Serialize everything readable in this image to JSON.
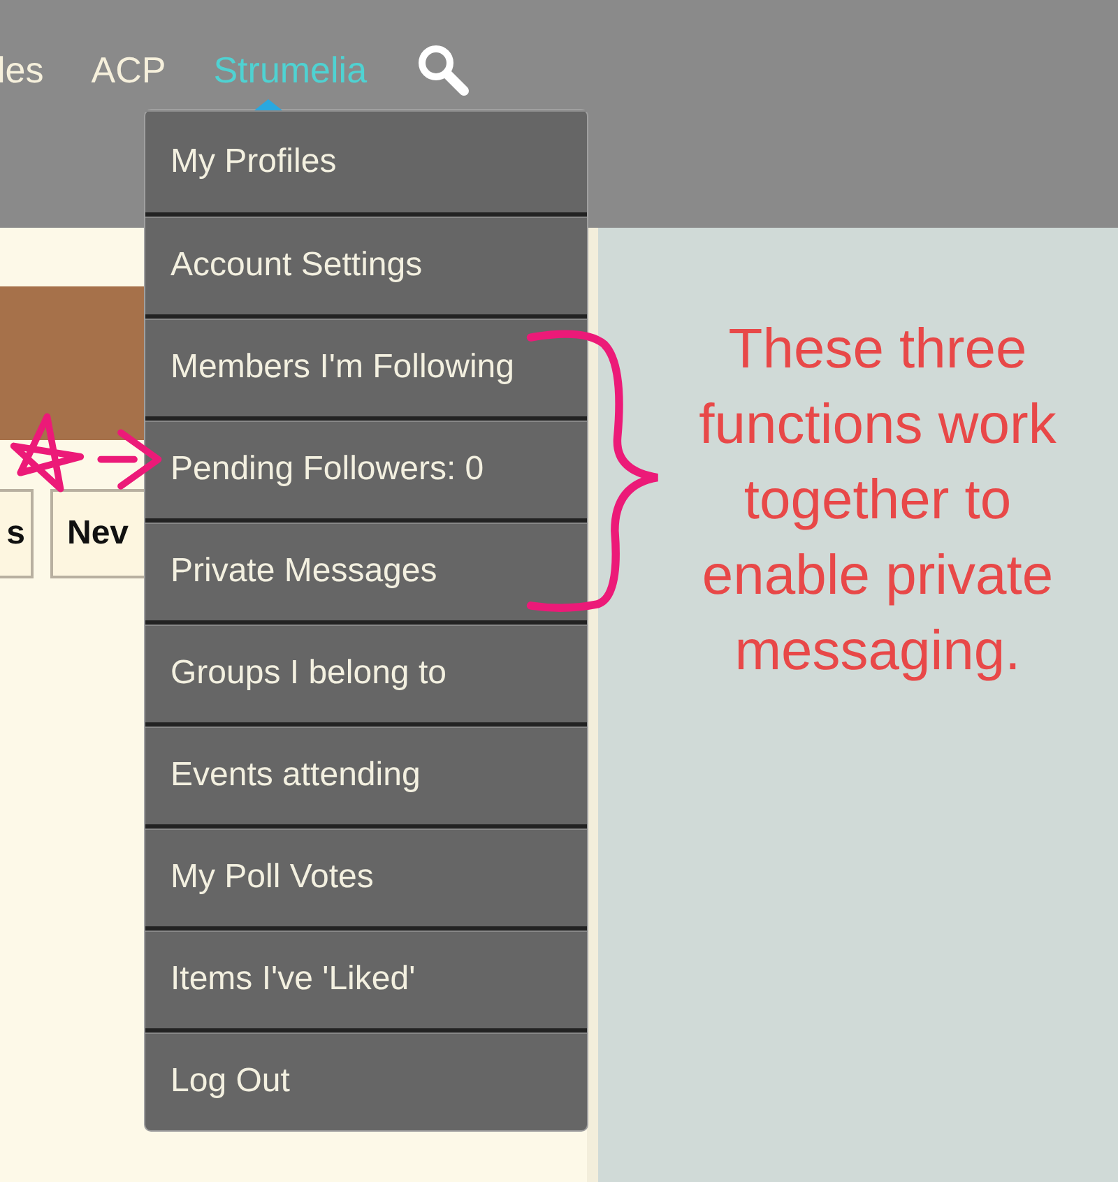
{
  "nav": {
    "items": [
      {
        "label": "les",
        "selected": false
      },
      {
        "label": "ACP",
        "selected": false
      },
      {
        "label": "Strumelia",
        "selected": true
      }
    ]
  },
  "content": {
    "buttons": [
      "s",
      "Nev"
    ]
  },
  "dropdown": {
    "items": [
      {
        "label": "My Profiles"
      },
      {
        "label": "Account Settings"
      },
      {
        "label": "Members I'm Following"
      },
      {
        "label": "Pending Followers: 0"
      },
      {
        "label": "Private Messages"
      },
      {
        "label": "Groups I belong to"
      },
      {
        "label": "Events attending"
      },
      {
        "label": "My Poll Votes"
      },
      {
        "label": "Items I've 'Liked'"
      },
      {
        "label": "Log Out"
      }
    ]
  },
  "annotation": {
    "text": "These three\nfunctions work\ntogether to\nenable private\nmessaging."
  }
}
